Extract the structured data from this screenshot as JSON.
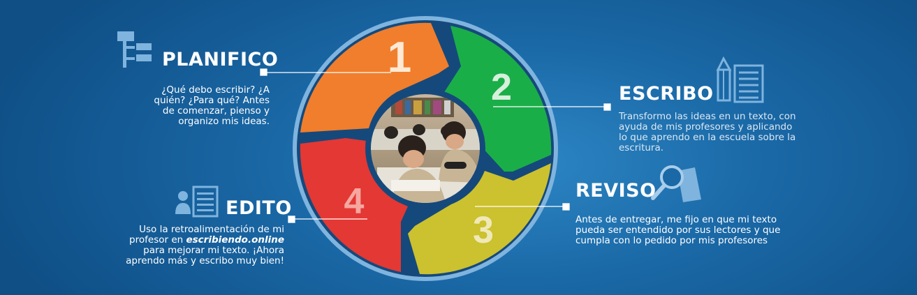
{
  "colors": {
    "step1": "#f07e2c",
    "step2": "#1aae48",
    "step3": "#ccc12e",
    "step4": "#e33834",
    "ring": "#15497c",
    "rim": "#7fb4de",
    "background": "#1a68a6"
  },
  "steps": [
    {
      "number": "1",
      "title": "PLANIFICO",
      "icon": "organize-diagram-icon",
      "description": "¿Qué debo escribir? ¿A quién? ¿Para qué? Antes de comenzar, pienso y organizo mis ideas."
    },
    {
      "number": "2",
      "title": "ESCRIBO",
      "icon": "pencil-document-icon",
      "description": "Transformo las ideas en un texto, con ayuda de mis profesores y aplicando lo que aprendo en la escuela sobre la escritura."
    },
    {
      "number": "3",
      "title": "REVISO",
      "icon": "magnifier-document-icon",
      "description": "Antes de entregar, me fijo en que mi texto pueda ser entendido por sus lectores y que cumpla con lo pedido por mis profesores"
    },
    {
      "number": "4",
      "title": "EDITO",
      "icon": "user-document-icon",
      "description_pre": "Uso la retroalimentación de mi profesor en",
      "description_link": "escribiendo.online",
      "description_post": "para mejorar mi texto. ¡Ahora aprendo más y escribo muy bien!"
    }
  ],
  "center_photo": "classroom-students-writing"
}
